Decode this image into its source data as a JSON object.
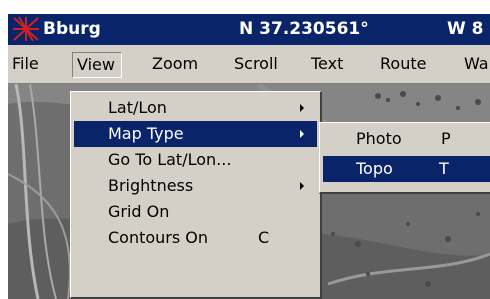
{
  "titlebar": {
    "app_name": "Bburg",
    "latitude": "N 37.230561°",
    "longitude": "W 8"
  },
  "menubar": {
    "items": [
      {
        "label": "File"
      },
      {
        "label": "View"
      },
      {
        "label": "Zoom"
      },
      {
        "label": "Scroll"
      },
      {
        "label": "Text"
      },
      {
        "label": "Route"
      },
      {
        "label": "Wa"
      }
    ],
    "active": "View"
  },
  "view_menu": {
    "items": [
      {
        "label": "Lat/Lon",
        "shortcut": "",
        "submenu": true
      },
      {
        "label": "Map Type",
        "shortcut": "",
        "submenu": true,
        "highlighted": true
      },
      {
        "label": "Go To Lat/Lon...",
        "shortcut": "",
        "submenu": false
      },
      {
        "label": "Brightness",
        "shortcut": "",
        "submenu": true
      },
      {
        "label": "Grid On",
        "shortcut": "",
        "submenu": false
      },
      {
        "label": "Contours On",
        "shortcut": "C",
        "submenu": false
      }
    ]
  },
  "map_type_submenu": {
    "items": [
      {
        "label": "Photo",
        "shortcut": "P"
      },
      {
        "label": "Topo",
        "shortcut": "T",
        "highlighted": true
      }
    ]
  },
  "colors": {
    "titlebar_bg": "#0a246a",
    "menu_bg": "#d4d0c8",
    "highlight_bg": "#0a246a",
    "highlight_text": "#ffffff",
    "app_icon": "#cc2222"
  },
  "icons": {
    "app": "compass-star-icon",
    "submenu": "triangle-right-icon"
  }
}
